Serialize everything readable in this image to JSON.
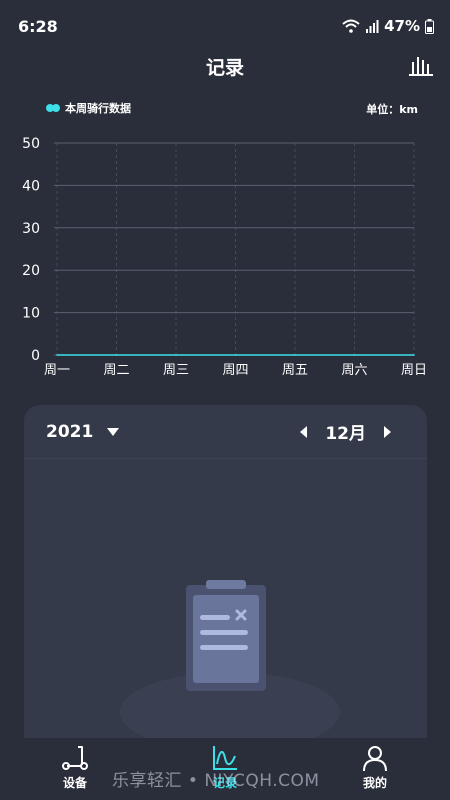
{
  "status": {
    "time": "6:28",
    "battery": "47%"
  },
  "header": {
    "title": "记录"
  },
  "legend": {
    "label": "本周骑行数据",
    "unit": "单位：km",
    "color": "#3de0e8"
  },
  "chart_data": {
    "type": "line",
    "categories": [
      "周一",
      "周二",
      "周三",
      "周四",
      "周五",
      "周六",
      "周日"
    ],
    "series": [
      {
        "name": "本周骑行数据",
        "values": [
          0,
          0,
          0,
          0,
          0,
          0,
          0
        ]
      }
    ],
    "y_ticks": [
      "50",
      "40",
      "30",
      "20",
      "10",
      "0"
    ],
    "ylim": [
      0,
      50
    ],
    "grid": true,
    "legend_position": "top-left"
  },
  "card": {
    "year": "2021",
    "month": "12月"
  },
  "tabs": [
    {
      "label": "设备",
      "icon": "scooter-icon",
      "active": false
    },
    {
      "label": "记录",
      "icon": "chart-line-icon",
      "active": true
    },
    {
      "label": "我的",
      "icon": "user-icon",
      "active": false
    }
  ],
  "watermark": "乐享轻汇 • NIYCQH.COM",
  "colors": {
    "background": "#2a2e3a",
    "card": "#353a4a",
    "accent": "#3de0e8"
  }
}
